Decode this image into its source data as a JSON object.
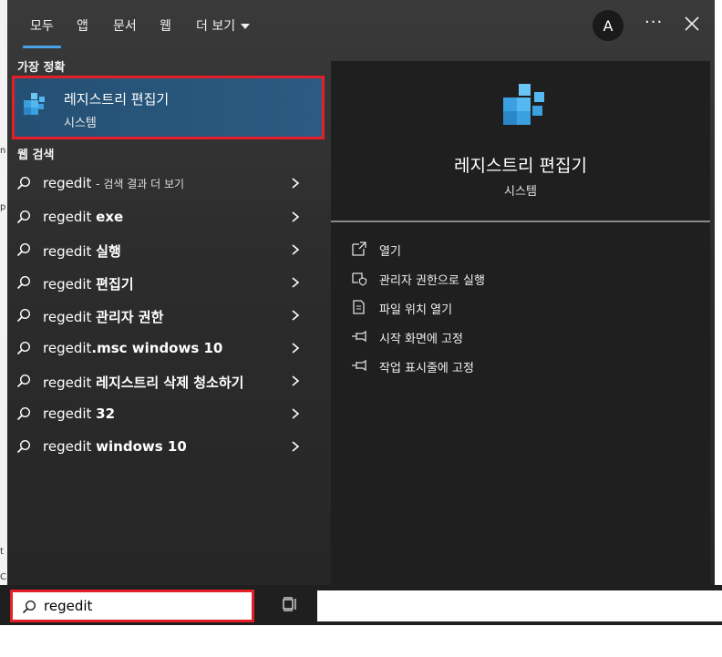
{
  "nav": {
    "tabs": [
      {
        "label": "모두",
        "active": true
      },
      {
        "label": "앱"
      },
      {
        "label": "문서"
      },
      {
        "label": "웹"
      },
      {
        "label": "더 보기"
      }
    ],
    "avatar_initial": "A",
    "more_label": "···"
  },
  "best_match": {
    "section_label": "가장 정확",
    "app_name": "레지스트리 편집기",
    "app_type": "시스템"
  },
  "web_search": {
    "section_label": "웹 검색",
    "items": [
      {
        "query": "regedit",
        "bold": "",
        "suffix": "- 검색 결과 더 보기"
      },
      {
        "query": "regedit",
        "bold": "exe",
        "suffix": ""
      },
      {
        "query": "regedit",
        "bold": "실행",
        "suffix": ""
      },
      {
        "query": "regedit",
        "bold": "편집기",
        "suffix": ""
      },
      {
        "query": "regedit",
        "bold": "관리자 권한",
        "suffix": ""
      },
      {
        "query": "regedit",
        "bold": ".msc windows 10",
        "suffix": ""
      },
      {
        "query": "regedit",
        "bold": "레지스트리 삭제 청소하기",
        "suffix": ""
      },
      {
        "query": "regedit",
        "bold": "32",
        "suffix": ""
      },
      {
        "query": "regedit",
        "bold": "windows 10",
        "suffix": ""
      }
    ]
  },
  "preview": {
    "title": "레지스트리 편집기",
    "subtitle": "시스템",
    "actions": [
      {
        "label": "열기",
        "icon": "open-icon"
      },
      {
        "label": "관리자 권한으로 실행",
        "icon": "shield-icon"
      },
      {
        "label": "파일 위치 열기",
        "icon": "file-location-icon"
      },
      {
        "label": "시작 화면에 고정",
        "icon": "pin-icon"
      },
      {
        "label": "작업 표시줄에 고정",
        "icon": "pin-icon"
      }
    ]
  },
  "taskbar": {
    "search_value": "regedit"
  },
  "colors": {
    "accent": "#4aa3e8",
    "highlight_border": "#e3202a",
    "best_match_bg": "#2c5a80"
  }
}
